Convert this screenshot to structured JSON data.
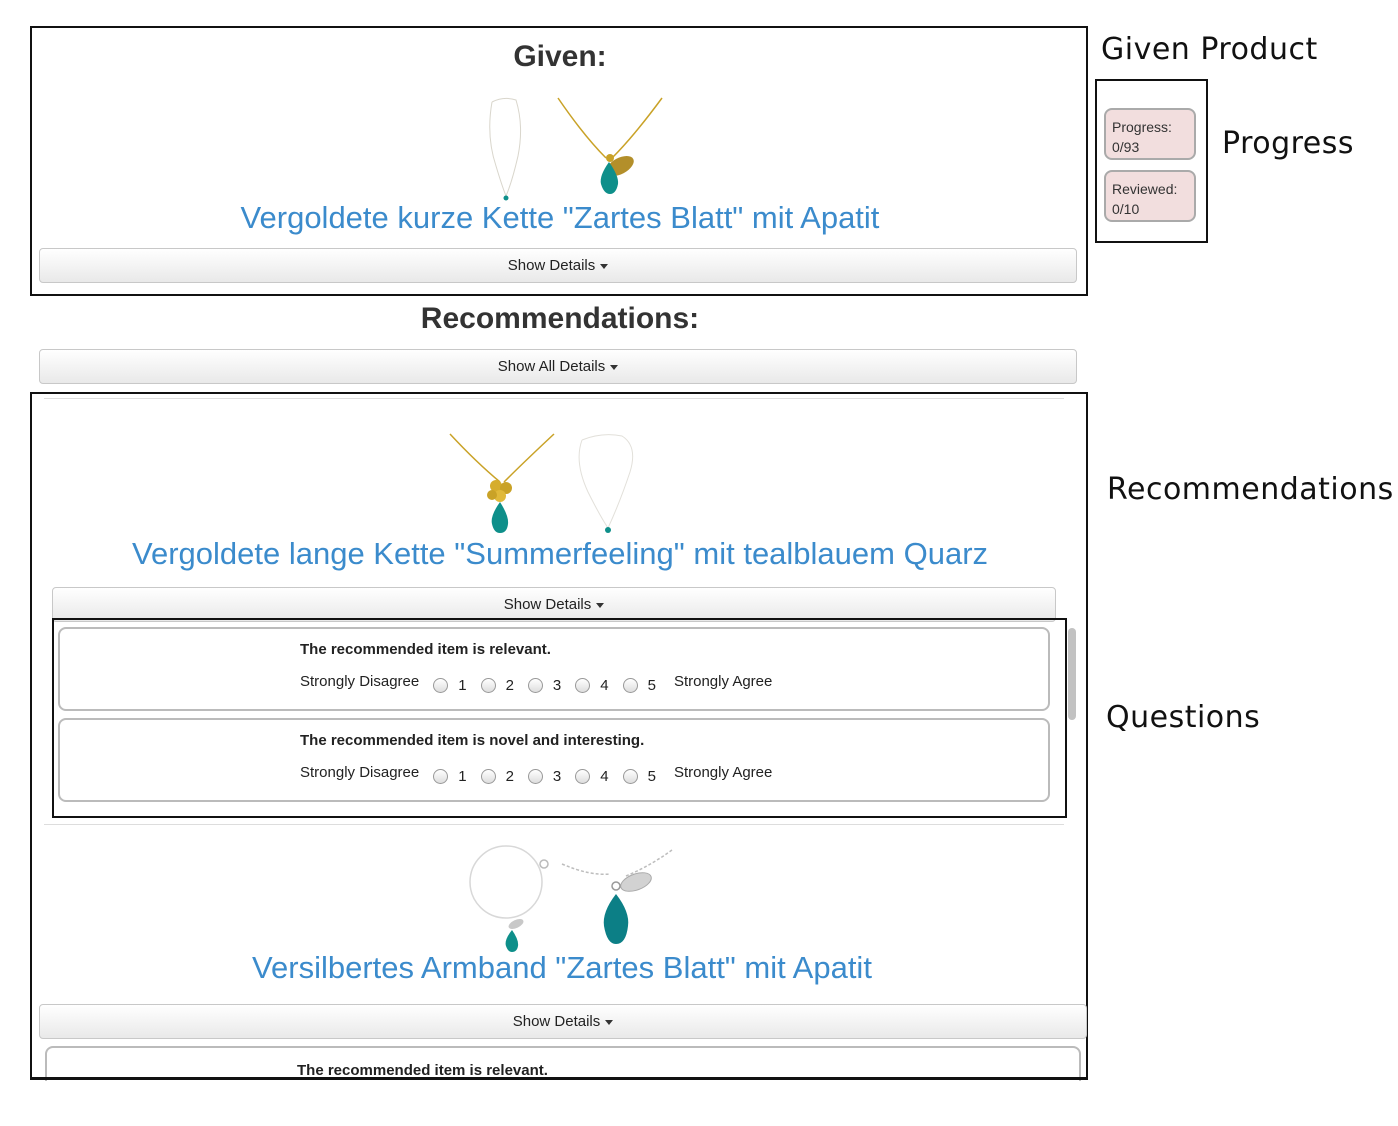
{
  "given": {
    "heading": "Given:",
    "title": "Vergoldete kurze Kette \"Zartes Blatt\" mit Apatit",
    "details_label": "Show Details"
  },
  "progress": {
    "progress_label": "Progress:",
    "progress_value": "0/93",
    "reviewed_label": "Reviewed:",
    "reviewed_value": "0/10"
  },
  "recommendations": {
    "heading": "Recommendations:",
    "show_all_label": "Show All Details",
    "items": [
      {
        "title": "Vergoldete lange Kette \"Summerfeeling\" mit tealblauem Quarz",
        "details_label": "Show Details"
      },
      {
        "title": "Versilbertes Armband \"Zartes Blatt\" mit Apatit",
        "details_label": "Show Details"
      }
    ]
  },
  "questions": [
    {
      "text": "The recommended item is relevant.",
      "left_label": "Strongly Disagree",
      "right_label": "Strongly Agree",
      "options": [
        "1",
        "2",
        "3",
        "4",
        "5"
      ]
    },
    {
      "text": "The recommended item is novel and interesting.",
      "left_label": "Strongly Disagree",
      "right_label": "Strongly Agree",
      "options": [
        "1",
        "2",
        "3",
        "4",
        "5"
      ]
    },
    {
      "text": "The recommended item is relevant."
    }
  ],
  "callouts": {
    "given_product": "Given Product",
    "progress": "Progress",
    "recommendations": "Recommendations",
    "questions": "Questions"
  },
  "colors": {
    "title_blue": "#3b8bcc",
    "progress_bg": "#f2dede",
    "gem_teal": "#0e8f8a",
    "gold": "#c9a227"
  },
  "icons": [
    "gold-necklace-leaf-icon",
    "thin-necklace-icon",
    "gold-necklace-flower-icon",
    "silver-bracelet-icon",
    "silver-necklace-leaf-icon"
  ]
}
